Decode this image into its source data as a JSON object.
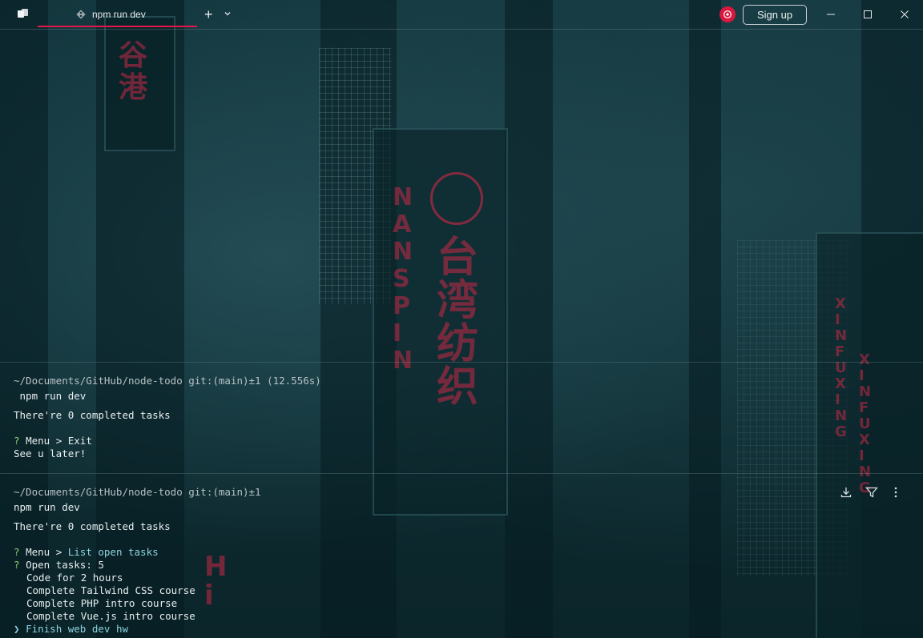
{
  "titlebar": {
    "tab_title": "npm run dev",
    "signup_label": "Sign up",
    "accent": "#e2184a"
  },
  "blocks": [
    {
      "path_line": "~/Documents/GitHub/node-todo git:(main)±1 (12.556s)",
      "command": " npm run dev",
      "output": [
        "There're 0 completed tasks",
        "",
        "? Menu > Exit",
        "See u later!"
      ],
      "prompt_mark": "?",
      "menu_prefix": "Menu > ",
      "menu_choice": "Exit",
      "bye": "See u later!",
      "completed": "There're 0 completed tasks"
    },
    {
      "path_line": "~/Documents/GitHub/node-todo git:(main)±1",
      "command": "npm run dev",
      "completed": "There're 0 completed tasks",
      "prompt_mark": "?",
      "menu_prefix": "Menu > ",
      "menu_choice": "List open tasks",
      "open_prefix": "Open tasks: ",
      "open_count": "5",
      "tasks": [
        "Code for 2 hours",
        "Complete Tailwind CSS course",
        "Complete PHP intro course",
        "Complete Vue.js intro course"
      ],
      "selected_marker": "❯",
      "selected_task": "Finish web dev hw"
    }
  ],
  "icons": {
    "app": "warp-app-icon",
    "tab": "git-icon",
    "new_tab": "plus-icon",
    "new_tab_menu": "chevron-down-icon",
    "logo": "warp-logo-icon",
    "download": "download-icon",
    "filter": "filter-icon",
    "more": "more-vertical-icon"
  }
}
